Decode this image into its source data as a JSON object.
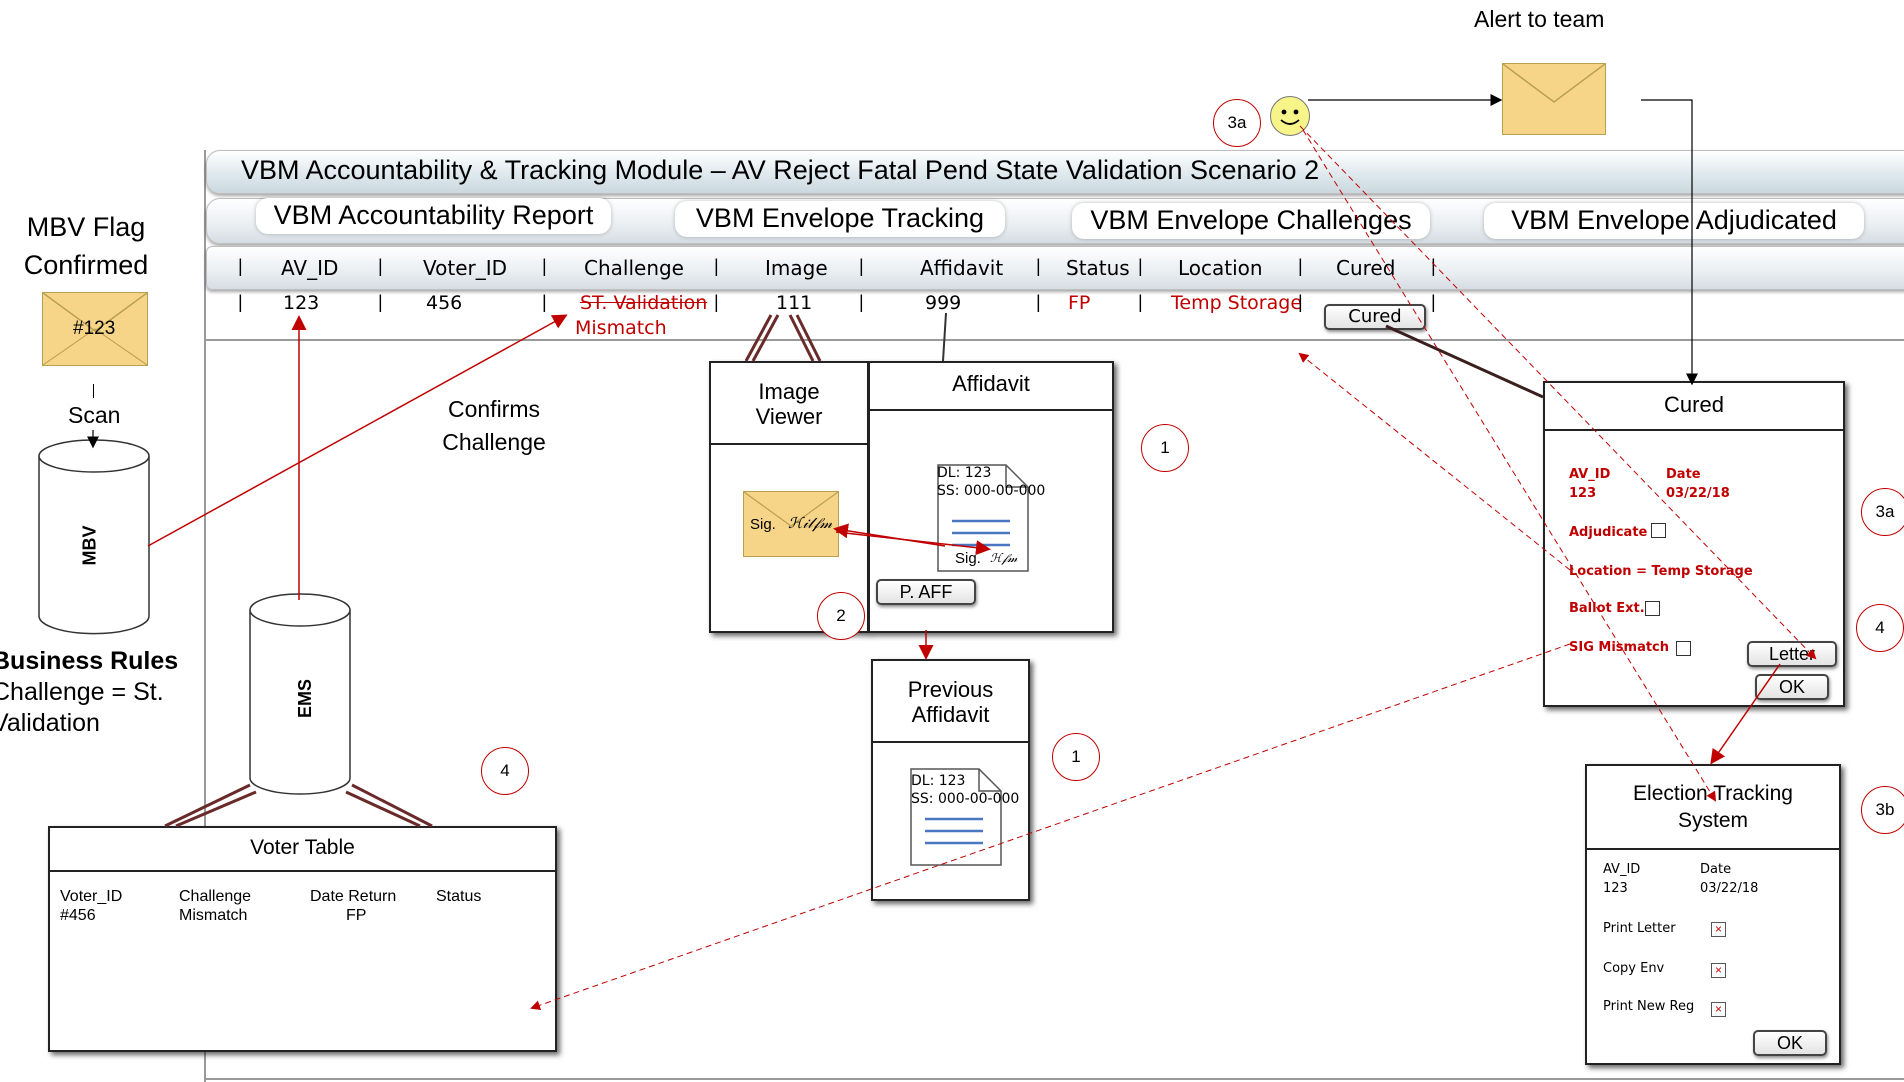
{
  "alert": {
    "label": "Alert to team"
  },
  "module_title": "VBM Accountability & Tracking Module – AV Reject Fatal Pend State Validation Scenario 2",
  "tabs": [
    "VBM Accountability Report",
    "VBM Envelope Tracking",
    "VBM Envelope Challenges",
    "VBM Envelope Adjudicated"
  ],
  "table": {
    "headers": [
      "AV_ID",
      "Voter_ID",
      "Challenge",
      "Image",
      "Affidavit",
      "Status",
      "Location",
      "Cured"
    ],
    "row": {
      "av_id": "123",
      "voter_id": "456",
      "challenge_line1": "ST. Validation",
      "challenge_line2": "Mismatch",
      "image": "111",
      "affidavit": "999",
      "status": "FP",
      "location": "Temp Storage",
      "cured_button": "Cured"
    }
  },
  "mbv": {
    "flag_line1": "MBV Flag",
    "flag_line2": "Confirmed",
    "envelope": "#123",
    "scan": "Scan",
    "db_label": "MBV"
  },
  "business_rules": {
    "title": "Business Rules",
    "line1": "Challenge = St.",
    "line2": "Validation"
  },
  "confirms": {
    "line1": "Confirms",
    "line2": "Challenge"
  },
  "ems": {
    "label": "EMS"
  },
  "image_viewer": {
    "title_line1": "Image",
    "title_line2": "Viewer",
    "sig": "Sig."
  },
  "affidavit_panel": {
    "title": "Affidavit",
    "dl": "DL: 123",
    "ss": "SS: 000-00-000",
    "sig": "Sig.",
    "button": "P. AFF"
  },
  "previous_affidavit": {
    "title_line1": "Previous",
    "title_line2": "Affidavit",
    "dl": "DL: 123",
    "ss": "SS: 000-00-000"
  },
  "cured_panel": {
    "title": "Cured",
    "av_id_label": "AV_ID",
    "av_id": "123",
    "date_label": "Date",
    "date": "03/22/18",
    "adjudicate": "Adjudicate",
    "location": "Location = Temp Storage",
    "ballot_ext": "Ballot Ext.",
    "sig_mismatch": "SIG Mismatch",
    "letter_button": "Letter",
    "ok_button": "OK"
  },
  "election_tracking": {
    "title_line1": "Election Tracking",
    "title_line2": "System",
    "av_id_label": "AV_ID",
    "av_id": "123",
    "date_label": "Date",
    "date": "03/22/18",
    "print_letter": "Print Letter",
    "copy_env": "Copy Env",
    "print_new_reg": "Print New Reg",
    "ok_button": "OK"
  },
  "voter_table": {
    "title": "Voter Table",
    "headers": [
      "Voter_ID",
      "Challenge",
      "Date Return",
      "Status"
    ],
    "row": [
      "#456",
      "Mismatch",
      "FP",
      ""
    ]
  },
  "step_markers": {
    "s1a": "1",
    "s1b": "1",
    "s2": "2",
    "s3a_top": "3a",
    "s3a_right": "3a",
    "s3b": "3b",
    "s4_right": "4",
    "s4_left": "4"
  },
  "colors": {
    "accent_red": "#c00000",
    "envelope": "#f6d488",
    "header_bar": "#e9eef2"
  }
}
